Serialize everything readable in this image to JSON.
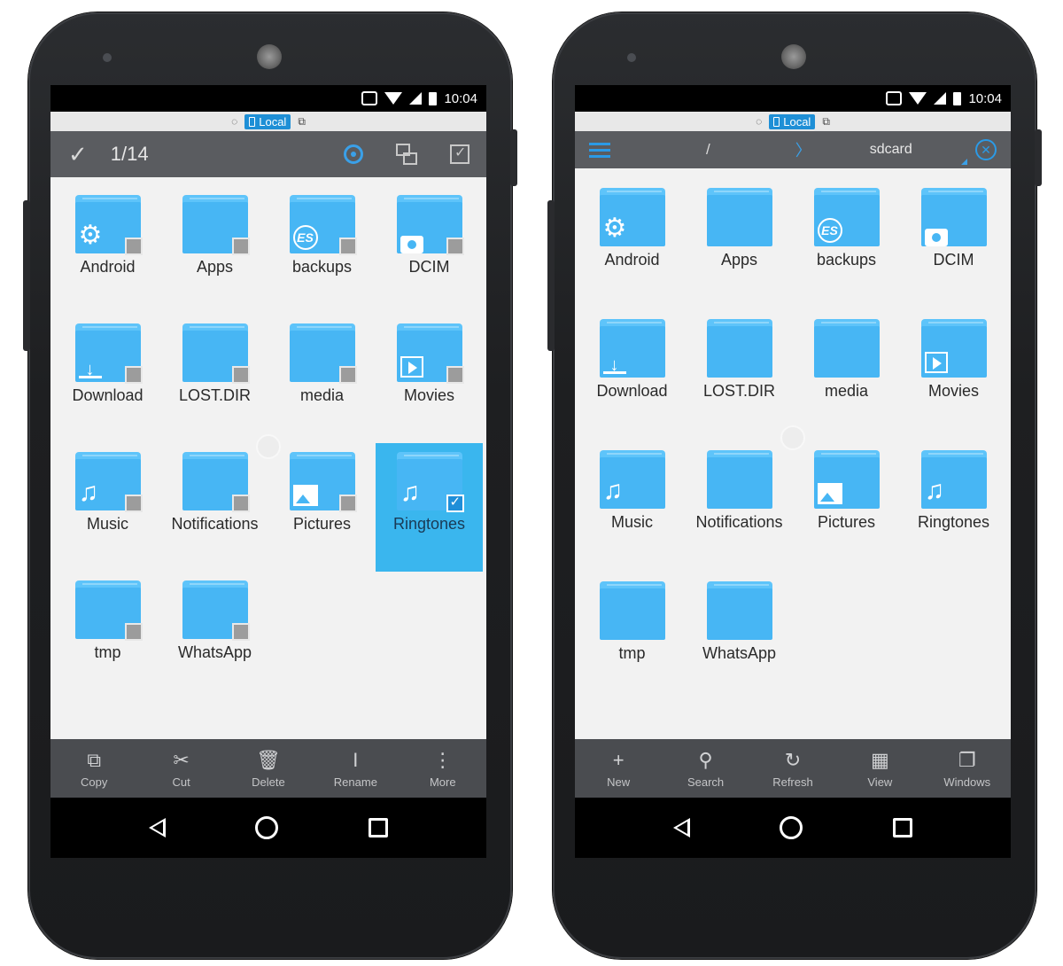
{
  "status": {
    "time": "10:04"
  },
  "location": {
    "label": "Local"
  },
  "left": {
    "selection_count": "1/14",
    "folders": [
      {
        "name": "Android",
        "glyph": "gear-icon",
        "selected": false
      },
      {
        "name": "Apps",
        "glyph": "",
        "selected": false
      },
      {
        "name": "backups",
        "glyph": "es-icon",
        "selected": false
      },
      {
        "name": "DCIM",
        "glyph": "camera-icon",
        "selected": false
      },
      {
        "name": "Download",
        "glyph": "download-icon",
        "selected": false
      },
      {
        "name": "LOST.DIR",
        "glyph": "",
        "selected": false
      },
      {
        "name": "media",
        "glyph": "",
        "selected": false
      },
      {
        "name": "Movies",
        "glyph": "play-icon",
        "selected": false
      },
      {
        "name": "Music",
        "glyph": "music-icon",
        "selected": false
      },
      {
        "name": "Notifications",
        "glyph": "",
        "selected": false
      },
      {
        "name": "Pictures",
        "glyph": "picture-icon",
        "selected": false
      },
      {
        "name": "Ringtones",
        "glyph": "music-icon",
        "selected": true
      },
      {
        "name": "tmp",
        "glyph": "",
        "selected": false
      },
      {
        "name": "WhatsApp",
        "glyph": "",
        "selected": false
      }
    ],
    "toolbar": [
      {
        "label": "Copy",
        "icon": "copy-icon"
      },
      {
        "label": "Cut",
        "icon": "cut-icon"
      },
      {
        "label": "Delete",
        "icon": "delete-icon"
      },
      {
        "label": "Rename",
        "icon": "rename-icon"
      },
      {
        "label": "More",
        "icon": "more-icon"
      }
    ]
  },
  "right": {
    "path_root": "/",
    "path_segment": "sdcard",
    "folders": [
      {
        "name": "Android",
        "glyph": "gear-icon"
      },
      {
        "name": "Apps",
        "glyph": ""
      },
      {
        "name": "backups",
        "glyph": "es-icon"
      },
      {
        "name": "DCIM",
        "glyph": "camera-icon"
      },
      {
        "name": "Download",
        "glyph": "download-icon"
      },
      {
        "name": "LOST.DIR",
        "glyph": ""
      },
      {
        "name": "media",
        "glyph": ""
      },
      {
        "name": "Movies",
        "glyph": "play-icon"
      },
      {
        "name": "Music",
        "glyph": "music-icon"
      },
      {
        "name": "Notifications",
        "glyph": ""
      },
      {
        "name": "Pictures",
        "glyph": "picture-icon"
      },
      {
        "name": "Ringtones",
        "glyph": "music-icon"
      },
      {
        "name": "tmp",
        "glyph": ""
      },
      {
        "name": "WhatsApp",
        "glyph": ""
      }
    ],
    "toolbar": [
      {
        "label": "New",
        "icon": "plus-icon"
      },
      {
        "label": "Search",
        "icon": "search-icon"
      },
      {
        "label": "Refresh",
        "icon": "refresh-icon"
      },
      {
        "label": "View",
        "icon": "grid-view-icon"
      },
      {
        "label": "Windows",
        "icon": "windows-icon"
      }
    ]
  },
  "colors": {
    "accent": "#2b9ae6",
    "folder": "#47b6f4",
    "selected_bg": "#3ab6ee",
    "toolbar_bg": "#5a5c60",
    "bottom_bg": "#4a4c50"
  }
}
